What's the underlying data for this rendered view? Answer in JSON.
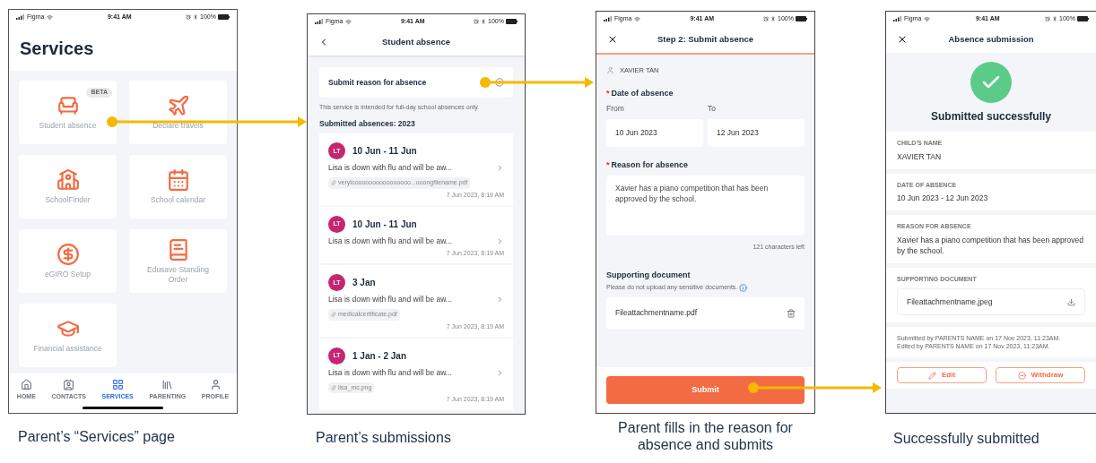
{
  "screens": [
    {
      "kind": "services",
      "status": {
        "carrier": "Figma",
        "time": "9:41 AM",
        "battery": "100%"
      },
      "title": "Services",
      "tiles": [
        {
          "label": "Student absence",
          "badge": "BETA"
        },
        {
          "label": "Declare travels"
        },
        {
          "label": "SchoolFinder"
        },
        {
          "label": "School calendar"
        },
        {
          "label": "eGIRO Setup"
        },
        {
          "label": "Edusave Standing Order"
        },
        {
          "label": "Financial assistance"
        }
      ],
      "nav": [
        {
          "label": "HOME",
          "selected": false
        },
        {
          "label": "CONTACTS",
          "selected": false
        },
        {
          "label": "SERVICES",
          "selected": true
        },
        {
          "label": "PARENTING",
          "selected": false
        },
        {
          "label": "PROFILE",
          "selected": false
        }
      ],
      "caption": "Parent’s “Services” page"
    },
    {
      "kind": "submissions",
      "status": {
        "carrier": "Figma",
        "time": "9:41 AM",
        "battery": "100%"
      },
      "title": "Student absence",
      "action": "Submit reason for absence",
      "note": "This service is intended for full-day school absences only.",
      "section": "Submitted absences: 2023",
      "items": [
        {
          "initials": "LT",
          "dates": "10 Jun - 11 Jun",
          "text": "Lisa is down with flu and will be aw...",
          "attachment": "verylooooooooooooooooo...ooongfilename.pdf",
          "time": "7 Jun 2023, 8:19 AM"
        },
        {
          "initials": "LT",
          "dates": "10 Jun - 11 Jun",
          "text": "Lisa is down with flu and will be aw...",
          "time": "7 Jun 2023, 8:19 AM"
        },
        {
          "initials": "LT",
          "dates": "3 Jan",
          "text": "Lisa is down with flu and will be aw...",
          "attachment": "medicalcertificate.pdf",
          "time": "7 Jun 2023, 8:19 AM"
        },
        {
          "initials": "LT",
          "dates": "1 Jan - 2 Jan",
          "text": "Lisa is down with flu and will be aw...",
          "attachment": "lisa_mc.png",
          "time": "7 Jun 2023, 8:19 AM"
        }
      ],
      "caption": "Parent’s submissions"
    },
    {
      "kind": "form",
      "status": {
        "carrier": "Figma",
        "time": "9:41 AM",
        "battery": "100%"
      },
      "title": "Step 2: Submit absence",
      "child": "XAVIER TAN",
      "date_label": {
        "marker": "*",
        "text": "Date of absence"
      },
      "from_label": "From",
      "to_label": "To",
      "from": "10 Jun 2023",
      "to": "12 Jun 2023",
      "reason_label": {
        "marker": "*",
        "text": "Reason for absence"
      },
      "reason": "Xavier has a piano competition that has been approved by the school.",
      "counter": "121 characters left",
      "doc_label": "Supporting document",
      "doc_hint": "Please do not upload any sensitive documents.",
      "file": "Fileattachmentname.pdf",
      "submit": "Submit",
      "caption": "Parent fills in the reason for absence and submits"
    },
    {
      "kind": "result",
      "status": {
        "carrier": "Figma",
        "time": "9:41 AM",
        "battery": "100%"
      },
      "title": "Absence submission",
      "heading": "Submitted successfully",
      "fields": [
        {
          "label": "CHILD'S NAME",
          "value": "XAVIER TAN"
        },
        {
          "label": "DATE OF ABSENCE",
          "value": "10 Jun 2023 - 12 Jun 2023"
        },
        {
          "label": "REASON FOR ABSENCE",
          "value": "Xavier has a piano competition that has been approved by the school."
        }
      ],
      "doc_label": "SUPPORTING DOCUMENT",
      "file": "Fileattachmentname.jpeg",
      "footnote": [
        "Submitted by PARENTS NAME on 17 Nov 2023, 11:23AM.",
        "Edited by PARENTS NAME on 17 Nov 2023, 11:23AM."
      ],
      "buttons": [
        {
          "label": "Edit",
          "kind": "edit"
        },
        {
          "label": "Withdraw",
          "kind": "withdraw"
        }
      ],
      "caption": "Successfully submitted"
    }
  ]
}
